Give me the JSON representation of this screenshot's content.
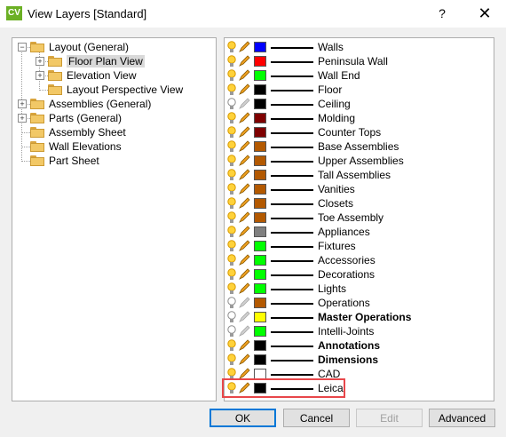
{
  "window": {
    "app_icon_text": "CV",
    "title": "View Layers [Standard]",
    "help_label": "?",
    "close_label": "✕"
  },
  "tree": {
    "items": [
      {
        "label": "Layout (General)",
        "expander": "−"
      },
      {
        "label": "Floor Plan View",
        "expander": "+",
        "selected": true
      },
      {
        "label": "Elevation View",
        "expander": "+"
      },
      {
        "label": "Layout Perspective View"
      },
      {
        "label": "Assemblies (General)",
        "expander": "+"
      },
      {
        "label": "Parts (General)",
        "expander": "+"
      },
      {
        "label": "Assembly Sheet"
      },
      {
        "label": "Wall Elevations"
      },
      {
        "label": "Part Sheet"
      }
    ]
  },
  "layers": {
    "items": [
      {
        "name": "Walls",
        "color": "#0000ff",
        "on": true,
        "bold": false
      },
      {
        "name": "Peninsula Wall",
        "color": "#ff0000",
        "on": true,
        "bold": false
      },
      {
        "name": "Wall End",
        "color": "#00ff00",
        "on": true,
        "bold": false
      },
      {
        "name": "Floor",
        "color": "#000000",
        "on": true,
        "bold": false
      },
      {
        "name": "Ceiling",
        "color": "#000000",
        "on": false,
        "bold": false
      },
      {
        "name": "Molding",
        "color": "#7f0000",
        "on": true,
        "bold": false
      },
      {
        "name": "Counter Tops",
        "color": "#7f0000",
        "on": true,
        "bold": false
      },
      {
        "name": "Base Assemblies",
        "color": "#b35900",
        "on": true,
        "bold": false
      },
      {
        "name": "Upper Assemblies",
        "color": "#b35900",
        "on": true,
        "bold": false
      },
      {
        "name": "Tall Assemblies",
        "color": "#b35900",
        "on": true,
        "bold": false
      },
      {
        "name": "Vanities",
        "color": "#b35900",
        "on": true,
        "bold": false
      },
      {
        "name": "Closets",
        "color": "#b35900",
        "on": true,
        "bold": false
      },
      {
        "name": "Toe Assembly",
        "color": "#b35900",
        "on": true,
        "bold": false
      },
      {
        "name": "Appliances",
        "color": "#808080",
        "on": true,
        "bold": false
      },
      {
        "name": "Fixtures",
        "color": "#00ff00",
        "on": true,
        "bold": false
      },
      {
        "name": "Accessories",
        "color": "#00ff00",
        "on": true,
        "bold": false
      },
      {
        "name": "Decorations",
        "color": "#00ff00",
        "on": true,
        "bold": false
      },
      {
        "name": "Lights",
        "color": "#00ff00",
        "on": true,
        "bold": false
      },
      {
        "name": "Operations",
        "color": "#b35900",
        "on": false,
        "bold": false
      },
      {
        "name": "Master Operations",
        "color": "#ffff00",
        "on": false,
        "bold": true
      },
      {
        "name": "Intelli-Joints",
        "color": "#00ff00",
        "on": false,
        "bold": false
      },
      {
        "name": "Annotations",
        "color": "#000000",
        "on": true,
        "bold": true
      },
      {
        "name": "Dimensions",
        "color": "#000000",
        "on": true,
        "bold": true
      },
      {
        "name": "CAD",
        "color": "#ffffff",
        "on": true,
        "bold": false
      },
      {
        "name": "Leica",
        "color": "#000000",
        "on": true,
        "bold": false
      }
    ]
  },
  "buttons": {
    "ok": "OK",
    "cancel": "Cancel",
    "edit": "Edit",
    "advanced": "Advanced"
  }
}
